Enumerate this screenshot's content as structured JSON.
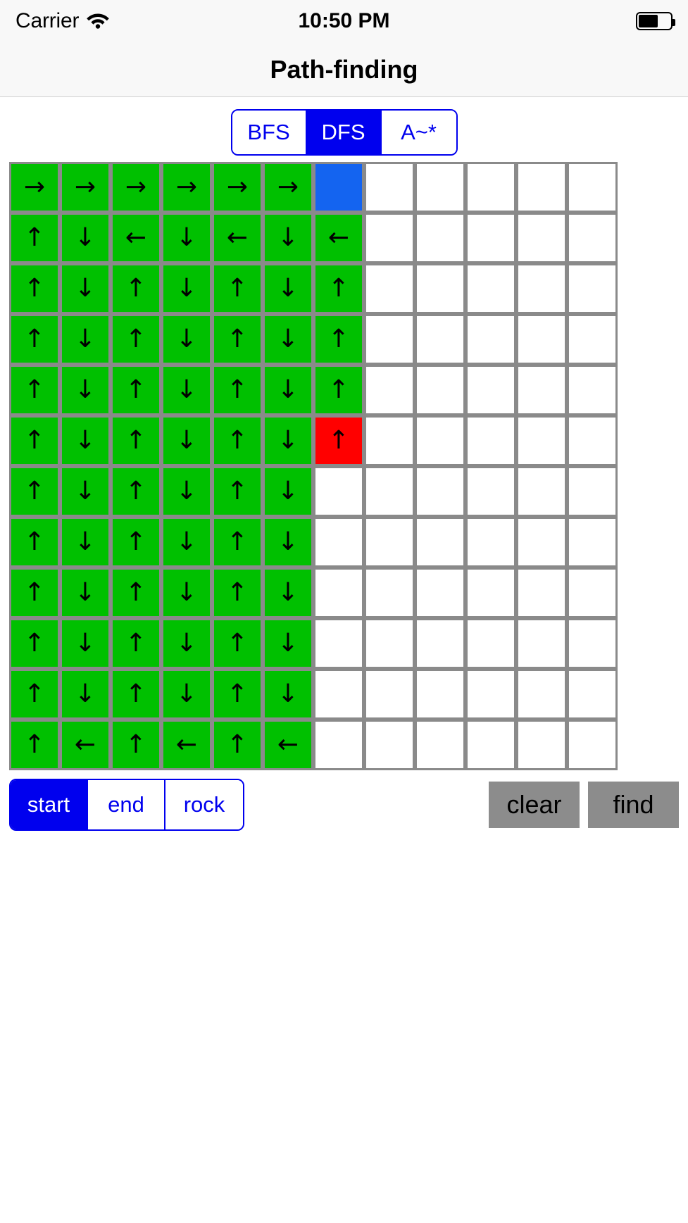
{
  "status_bar": {
    "carrier": "Carrier",
    "wifi_icon": "wifi-icon",
    "time": "10:50 PM",
    "battery_icon": "battery-icon"
  },
  "nav": {
    "title": "Path-finding"
  },
  "algorithm_segmented": {
    "options": [
      "BFS",
      "DFS",
      "A~*"
    ],
    "selected": "DFS",
    "selected_index": 1
  },
  "tool_segmented": {
    "options": [
      "start",
      "end",
      "rock"
    ],
    "selected": "start",
    "selected_index": 0
  },
  "actions": {
    "clear_label": "clear",
    "find_label": "find"
  },
  "colors": {
    "accent_blue": "#0000ee",
    "visited_green": "#00c000",
    "start_blue": "#1464f0",
    "end_red": "#ff0000",
    "button_gray": "#8c8c8c",
    "cell_border": "#8a8a8a"
  },
  "grid": {
    "rows": 12,
    "cols": 12,
    "legend": {
      "green": "visited cell with direction arrow",
      "blue": "start cell",
      "red": "end cell",
      "empty": "unvisited cell"
    },
    "cells": [
      [
        {
          "state": "green",
          "arrow": "→"
        },
        {
          "state": "green",
          "arrow": "→"
        },
        {
          "state": "green",
          "arrow": "→"
        },
        {
          "state": "green",
          "arrow": "→"
        },
        {
          "state": "green",
          "arrow": "→"
        },
        {
          "state": "green",
          "arrow": "→"
        },
        {
          "state": "blue",
          "arrow": ""
        },
        {
          "state": "empty",
          "arrow": ""
        },
        {
          "state": "empty",
          "arrow": ""
        },
        {
          "state": "empty",
          "arrow": ""
        },
        {
          "state": "empty",
          "arrow": ""
        },
        {
          "state": "empty",
          "arrow": ""
        }
      ],
      [
        {
          "state": "green",
          "arrow": "↑"
        },
        {
          "state": "green",
          "arrow": "↓"
        },
        {
          "state": "green",
          "arrow": "←"
        },
        {
          "state": "green",
          "arrow": "↓"
        },
        {
          "state": "green",
          "arrow": "←"
        },
        {
          "state": "green",
          "arrow": "↓"
        },
        {
          "state": "green",
          "arrow": "←"
        },
        {
          "state": "empty",
          "arrow": ""
        },
        {
          "state": "empty",
          "arrow": ""
        },
        {
          "state": "empty",
          "arrow": ""
        },
        {
          "state": "empty",
          "arrow": ""
        },
        {
          "state": "empty",
          "arrow": ""
        }
      ],
      [
        {
          "state": "green",
          "arrow": "↑"
        },
        {
          "state": "green",
          "arrow": "↓"
        },
        {
          "state": "green",
          "arrow": "↑"
        },
        {
          "state": "green",
          "arrow": "↓"
        },
        {
          "state": "green",
          "arrow": "↑"
        },
        {
          "state": "green",
          "arrow": "↓"
        },
        {
          "state": "green",
          "arrow": "↑"
        },
        {
          "state": "empty",
          "arrow": ""
        },
        {
          "state": "empty",
          "arrow": ""
        },
        {
          "state": "empty",
          "arrow": ""
        },
        {
          "state": "empty",
          "arrow": ""
        },
        {
          "state": "empty",
          "arrow": ""
        }
      ],
      [
        {
          "state": "green",
          "arrow": "↑"
        },
        {
          "state": "green",
          "arrow": "↓"
        },
        {
          "state": "green",
          "arrow": "↑"
        },
        {
          "state": "green",
          "arrow": "↓"
        },
        {
          "state": "green",
          "arrow": "↑"
        },
        {
          "state": "green",
          "arrow": "↓"
        },
        {
          "state": "green",
          "arrow": "↑"
        },
        {
          "state": "empty",
          "arrow": ""
        },
        {
          "state": "empty",
          "arrow": ""
        },
        {
          "state": "empty",
          "arrow": ""
        },
        {
          "state": "empty",
          "arrow": ""
        },
        {
          "state": "empty",
          "arrow": ""
        }
      ],
      [
        {
          "state": "green",
          "arrow": "↑"
        },
        {
          "state": "green",
          "arrow": "↓"
        },
        {
          "state": "green",
          "arrow": "↑"
        },
        {
          "state": "green",
          "arrow": "↓"
        },
        {
          "state": "green",
          "arrow": "↑"
        },
        {
          "state": "green",
          "arrow": "↓"
        },
        {
          "state": "green",
          "arrow": "↑"
        },
        {
          "state": "empty",
          "arrow": ""
        },
        {
          "state": "empty",
          "arrow": ""
        },
        {
          "state": "empty",
          "arrow": ""
        },
        {
          "state": "empty",
          "arrow": ""
        },
        {
          "state": "empty",
          "arrow": ""
        }
      ],
      [
        {
          "state": "green",
          "arrow": "↑"
        },
        {
          "state": "green",
          "arrow": "↓"
        },
        {
          "state": "green",
          "arrow": "↑"
        },
        {
          "state": "green",
          "arrow": "↓"
        },
        {
          "state": "green",
          "arrow": "↑"
        },
        {
          "state": "green",
          "arrow": "↓"
        },
        {
          "state": "red",
          "arrow": "↑"
        },
        {
          "state": "empty",
          "arrow": ""
        },
        {
          "state": "empty",
          "arrow": ""
        },
        {
          "state": "empty",
          "arrow": ""
        },
        {
          "state": "empty",
          "arrow": ""
        },
        {
          "state": "empty",
          "arrow": ""
        }
      ],
      [
        {
          "state": "green",
          "arrow": "↑"
        },
        {
          "state": "green",
          "arrow": "↓"
        },
        {
          "state": "green",
          "arrow": "↑"
        },
        {
          "state": "green",
          "arrow": "↓"
        },
        {
          "state": "green",
          "arrow": "↑"
        },
        {
          "state": "green",
          "arrow": "↓"
        },
        {
          "state": "empty",
          "arrow": ""
        },
        {
          "state": "empty",
          "arrow": ""
        },
        {
          "state": "empty",
          "arrow": ""
        },
        {
          "state": "empty",
          "arrow": ""
        },
        {
          "state": "empty",
          "arrow": ""
        },
        {
          "state": "empty",
          "arrow": ""
        }
      ],
      [
        {
          "state": "green",
          "arrow": "↑"
        },
        {
          "state": "green",
          "arrow": "↓"
        },
        {
          "state": "green",
          "arrow": "↑"
        },
        {
          "state": "green",
          "arrow": "↓"
        },
        {
          "state": "green",
          "arrow": "↑"
        },
        {
          "state": "green",
          "arrow": "↓"
        },
        {
          "state": "empty",
          "arrow": ""
        },
        {
          "state": "empty",
          "arrow": ""
        },
        {
          "state": "empty",
          "arrow": ""
        },
        {
          "state": "empty",
          "arrow": ""
        },
        {
          "state": "empty",
          "arrow": ""
        },
        {
          "state": "empty",
          "arrow": ""
        }
      ],
      [
        {
          "state": "green",
          "arrow": "↑"
        },
        {
          "state": "green",
          "arrow": "↓"
        },
        {
          "state": "green",
          "arrow": "↑"
        },
        {
          "state": "green",
          "arrow": "↓"
        },
        {
          "state": "green",
          "arrow": "↑"
        },
        {
          "state": "green",
          "arrow": "↓"
        },
        {
          "state": "empty",
          "arrow": ""
        },
        {
          "state": "empty",
          "arrow": ""
        },
        {
          "state": "empty",
          "arrow": ""
        },
        {
          "state": "empty",
          "arrow": ""
        },
        {
          "state": "empty",
          "arrow": ""
        },
        {
          "state": "empty",
          "arrow": ""
        }
      ],
      [
        {
          "state": "green",
          "arrow": "↑"
        },
        {
          "state": "green",
          "arrow": "↓"
        },
        {
          "state": "green",
          "arrow": "↑"
        },
        {
          "state": "green",
          "arrow": "↓"
        },
        {
          "state": "green",
          "arrow": "↑"
        },
        {
          "state": "green",
          "arrow": "↓"
        },
        {
          "state": "empty",
          "arrow": ""
        },
        {
          "state": "empty",
          "arrow": ""
        },
        {
          "state": "empty",
          "arrow": ""
        },
        {
          "state": "empty",
          "arrow": ""
        },
        {
          "state": "empty",
          "arrow": ""
        },
        {
          "state": "empty",
          "arrow": ""
        }
      ],
      [
        {
          "state": "green",
          "arrow": "↑"
        },
        {
          "state": "green",
          "arrow": "↓"
        },
        {
          "state": "green",
          "arrow": "↑"
        },
        {
          "state": "green",
          "arrow": "↓"
        },
        {
          "state": "green",
          "arrow": "↑"
        },
        {
          "state": "green",
          "arrow": "↓"
        },
        {
          "state": "empty",
          "arrow": ""
        },
        {
          "state": "empty",
          "arrow": ""
        },
        {
          "state": "empty",
          "arrow": ""
        },
        {
          "state": "empty",
          "arrow": ""
        },
        {
          "state": "empty",
          "arrow": ""
        },
        {
          "state": "empty",
          "arrow": ""
        }
      ],
      [
        {
          "state": "green",
          "arrow": "↑"
        },
        {
          "state": "green",
          "arrow": "←"
        },
        {
          "state": "green",
          "arrow": "↑"
        },
        {
          "state": "green",
          "arrow": "←"
        },
        {
          "state": "green",
          "arrow": "↑"
        },
        {
          "state": "green",
          "arrow": "←"
        },
        {
          "state": "empty",
          "arrow": ""
        },
        {
          "state": "empty",
          "arrow": ""
        },
        {
          "state": "empty",
          "arrow": ""
        },
        {
          "state": "empty",
          "arrow": ""
        },
        {
          "state": "empty",
          "arrow": ""
        },
        {
          "state": "empty",
          "arrow": ""
        }
      ]
    ]
  }
}
